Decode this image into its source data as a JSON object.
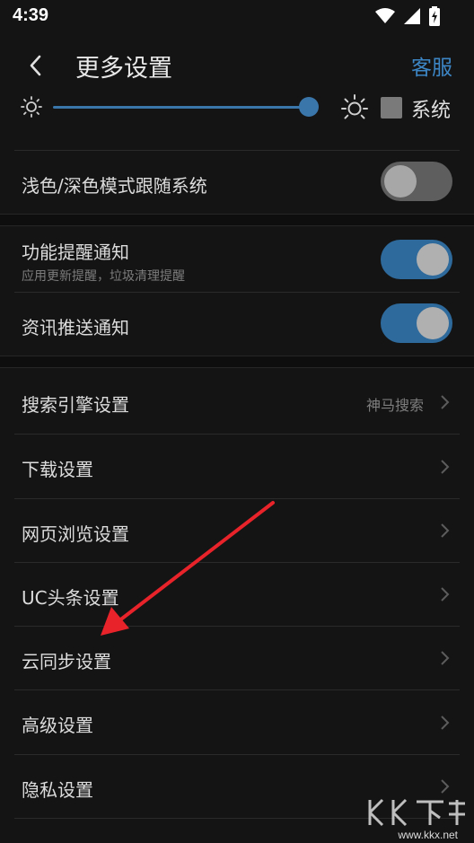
{
  "status_bar": {
    "time": "4:39"
  },
  "header": {
    "title": "更多设置",
    "service_label": "客服"
  },
  "brightness": {
    "level": 0.97,
    "system_label": "系统"
  },
  "theme_row": {
    "label": "浅色/深色模式跟随系统",
    "enabled": false
  },
  "feature_notify": {
    "label": "功能提醒通知",
    "sub": "应用更新提醒，垃圾清理提醒",
    "enabled": true
  },
  "news_notify": {
    "label": "资讯推送通知",
    "enabled": true
  },
  "settings_list": [
    {
      "label": "搜索引擎设置",
      "value": "神马搜索"
    },
    {
      "label": "下载设置"
    },
    {
      "label": "网页浏览设置"
    },
    {
      "label": "UC头条设置"
    },
    {
      "label": "云同步设置"
    },
    {
      "label": "高级设置"
    },
    {
      "label": "隐私设置"
    }
  ],
  "watermark": {
    "text": "www.kkx.net"
  },
  "colors": {
    "accent": "#3d86c6",
    "background": "#141414",
    "arrow": "#e8232a"
  }
}
